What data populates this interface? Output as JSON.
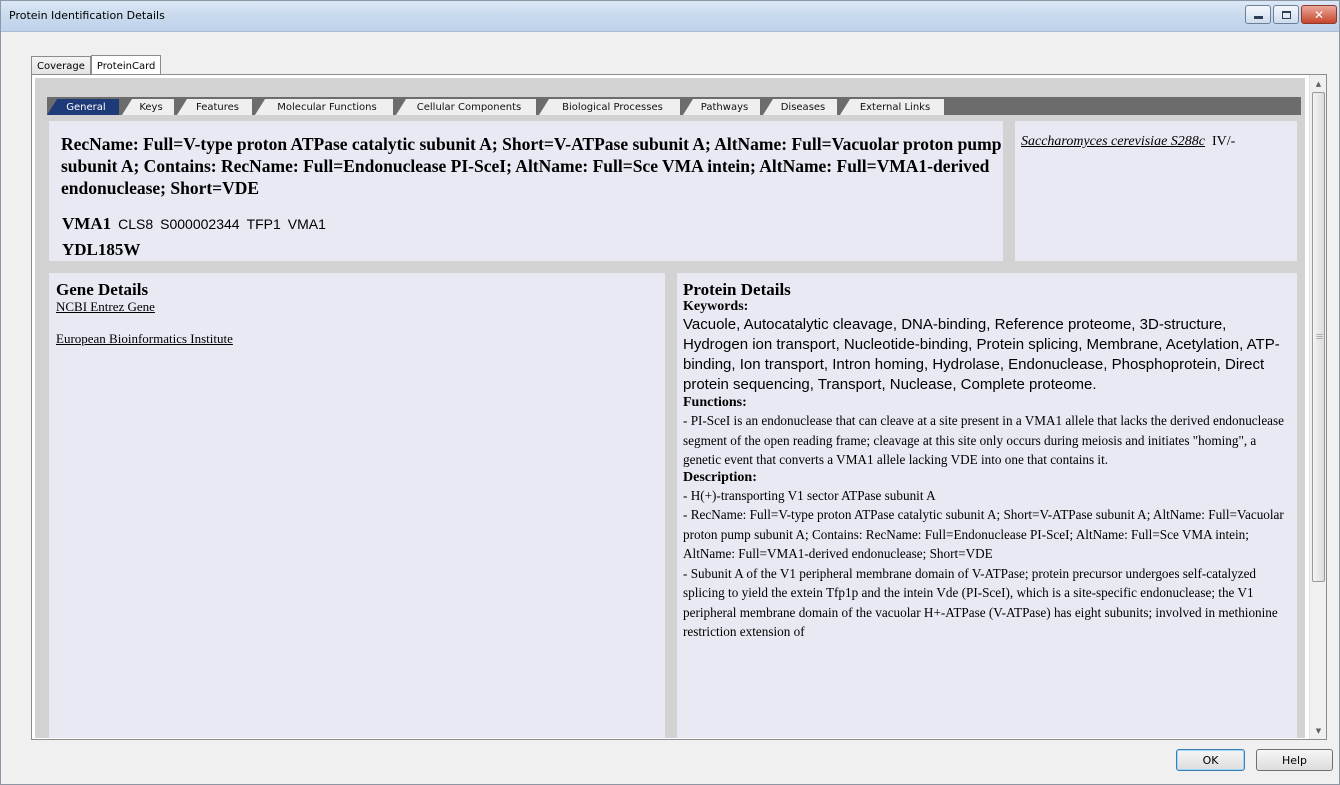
{
  "window": {
    "title": "Protein Identification Details"
  },
  "outer_tabs": [
    {
      "label": "Coverage",
      "active": false
    },
    {
      "label": "ProteinCard",
      "active": true
    }
  ],
  "inner_tabs": [
    {
      "label": "General",
      "active": true
    },
    {
      "label": "Keys"
    },
    {
      "label": "Features"
    },
    {
      "label": "Molecular Functions"
    },
    {
      "label": "Cellular Components"
    },
    {
      "label": "Biological Processes"
    },
    {
      "label": "Pathways"
    },
    {
      "label": "Diseases"
    },
    {
      "label": "External Links"
    }
  ],
  "header": {
    "rec_name": "RecName: Full=V-type proton ATPase catalytic subunit A; Short=V-ATPase subunit A; AltName: Full=Vacuolar proton pump subunit A; Contains: RecName: Full=Endonuclease PI-SceI; AltName: Full=Sce VMA intein; AltName: Full=VMA1-derived endonuclease; Short=VDE",
    "gene_primary": "VMA1",
    "gene_synonyms": [
      "CLS8",
      "S000002344",
      "TFP1",
      "VMA1"
    ],
    "locus": "YDL185W",
    "organism": "Saccharomyces cerevisiae S288c",
    "chromosome": "IV/-"
  },
  "gene_details": {
    "title": "Gene Details",
    "links": [
      "NCBI Entrez Gene",
      "European Bioinformatics Institute"
    ]
  },
  "protein_details": {
    "title": "Protein Details",
    "keywords_label": "Keywords:",
    "keywords": "Vacuole, Autocatalytic cleavage, DNA-binding, Reference proteome, 3D-structure, Hydrogen ion transport, Nucleotide-binding, Protein splicing, Membrane, Acetylation, ATP-binding, Ion transport, Intron homing, Hydrolase, Endonuclease, Phosphoprotein, Direct protein sequencing, Transport, Nuclease, Complete proteome.",
    "functions_label": "Functions:",
    "functions": "- PI-SceI is an endonuclease that can cleave at a site present in a VMA1 allele that lacks the derived endonuclease segment of the open reading frame; cleavage at this site only occurs during meiosis and initiates \"homing\", a genetic event that converts a VMA1 allele lacking VDE into one that contains it.",
    "description_label": "Description:",
    "description": [
      "- H(+)-transporting V1 sector ATPase subunit A",
      "- RecName: Full=V-type proton ATPase catalytic subunit A; Short=V-ATPase subunit A; AltName: Full=Vacuolar proton pump subunit A; Contains: RecName: Full=Endonuclease PI-SceI; AltName: Full=Sce VMA intein; AltName: Full=VMA1-derived endonuclease; Short=VDE",
      "- Subunit A of the V1 peripheral membrane domain of V-ATPase; protein precursor undergoes self-catalyzed splicing to yield the extein Tfp1p and the intein Vde (PI-SceI), which is a site-specific endonuclease; the V1 peripheral membrane domain of the vacuolar H+-ATPase (V-ATPase) has eight subunits; involved in methionine restriction extension of"
    ]
  },
  "buttons": {
    "ok": "OK",
    "help": "Help"
  }
}
